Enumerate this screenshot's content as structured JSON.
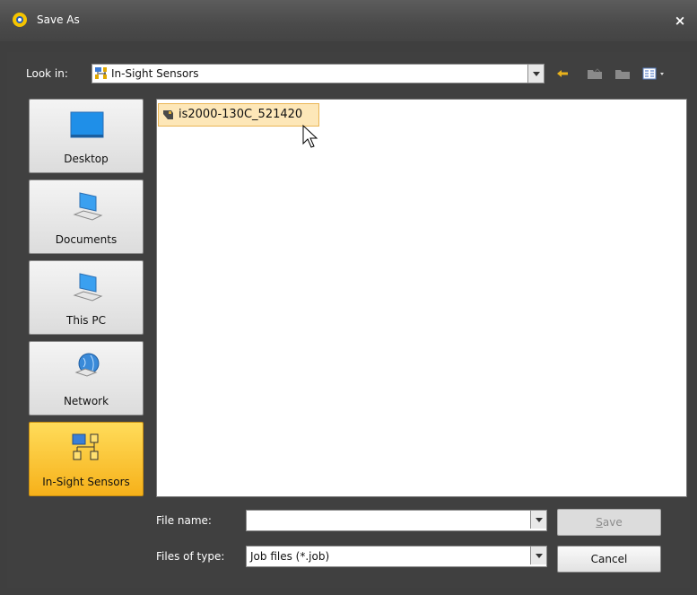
{
  "window": {
    "title": "Save As",
    "close_symbol": "×"
  },
  "toolbar": {
    "look_in_label": "Look in:",
    "look_in_value": "In-Sight Sensors",
    "icons": [
      "back-arrow-icon",
      "up-folder-icon",
      "new-folder-icon",
      "view-menu-icon"
    ]
  },
  "places": [
    {
      "label": "Desktop",
      "icon": "desktop-icon",
      "active": false
    },
    {
      "label": "Documents",
      "icon": "computer-icon",
      "active": false
    },
    {
      "label": "This PC",
      "icon": "computer-icon",
      "active": false
    },
    {
      "label": "Network",
      "icon": "network-globe-icon",
      "active": false
    },
    {
      "label": "In-Sight Sensors",
      "icon": "sensor-network-icon",
      "active": true
    }
  ],
  "files": [
    {
      "name": "is2000-130C_521420",
      "icon": "camera-sensor-icon",
      "selected": true
    }
  ],
  "form": {
    "file_name_label": "File name:",
    "file_name_value": "",
    "file_type_label": "Files of type:",
    "file_type_value": "Job files (*.job)"
  },
  "buttons": {
    "save_initial": "S",
    "save_rest": "ave",
    "cancel": "Cancel"
  },
  "colors": {
    "accent": "#f6b11a",
    "selection": "#fde7b8",
    "chrome": "#404040"
  }
}
